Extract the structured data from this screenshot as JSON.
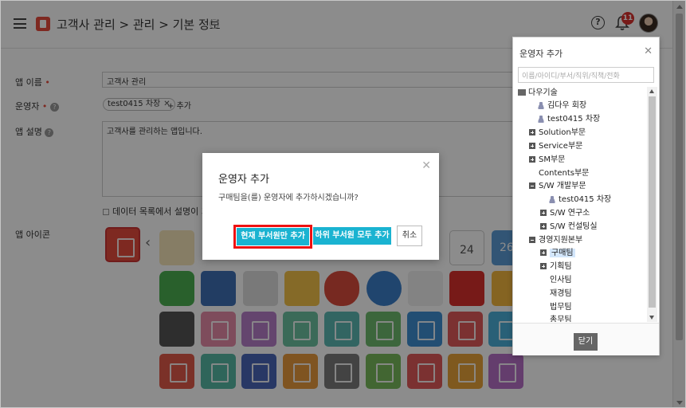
{
  "header": {
    "breadcrumb": "고객사 관리 > 관리 > 기본 정보",
    "notification_count": "11"
  },
  "form": {
    "app_name_label": "앱 이름",
    "app_name_value": "고객사 관리",
    "operator_label": "운영자",
    "operator_tag": "test0415 차장",
    "add_label": "+ 추가",
    "desc_label": "앱 설명",
    "desc_value": "고객사를 관리하는 앱입니다.",
    "show_desc_label": "데이터 목록에서 설명이 기본",
    "icon_label": "앱 아이콘",
    "cal_day": "24",
    "cal_day2": "26"
  },
  "panel": {
    "title": "운영자 추가",
    "search_placeholder": "이름/아이디/부서/직위/직책/전화",
    "close_button": "닫기",
    "tree": [
      {
        "label": "다우기술",
        "type": "root"
      },
      {
        "label": "김다우 회장",
        "type": "user"
      },
      {
        "label": "test0415 차장",
        "type": "user"
      },
      {
        "label": "Solution부문",
        "type": "group"
      },
      {
        "label": "Service부문",
        "type": "group"
      },
      {
        "label": "SM부문",
        "type": "group"
      },
      {
        "label": "Contents부문",
        "type": "plain"
      },
      {
        "label": "S/W 개발부문",
        "type": "group-open"
      },
      {
        "label": "test0415 차장",
        "type": "user"
      },
      {
        "label": "S/W 연구소",
        "type": "group"
      },
      {
        "label": "S/W 컨설팅실",
        "type": "group"
      },
      {
        "label": "경영지원본부",
        "type": "group-open"
      },
      {
        "label": "구매팀",
        "type": "group-selected"
      },
      {
        "label": "기획팀",
        "type": "group"
      },
      {
        "label": "인사팀",
        "type": "plain"
      },
      {
        "label": "재경팀",
        "type": "plain"
      },
      {
        "label": "법무팀",
        "type": "plain"
      },
      {
        "label": "총무팀",
        "type": "plain"
      }
    ]
  },
  "modal": {
    "title": "운영자 추가",
    "message": "구매팀을(를) 운영자에 추가하시겠습니까?",
    "btn_current": "현재 부서원만 추가",
    "btn_all": "하위 부서원 모두 추가",
    "btn_cancel": "취소"
  },
  "colors": {
    "accent": "#1ab3d1",
    "highlight_border": "#e11111",
    "brand_red": "#e64b3c"
  }
}
